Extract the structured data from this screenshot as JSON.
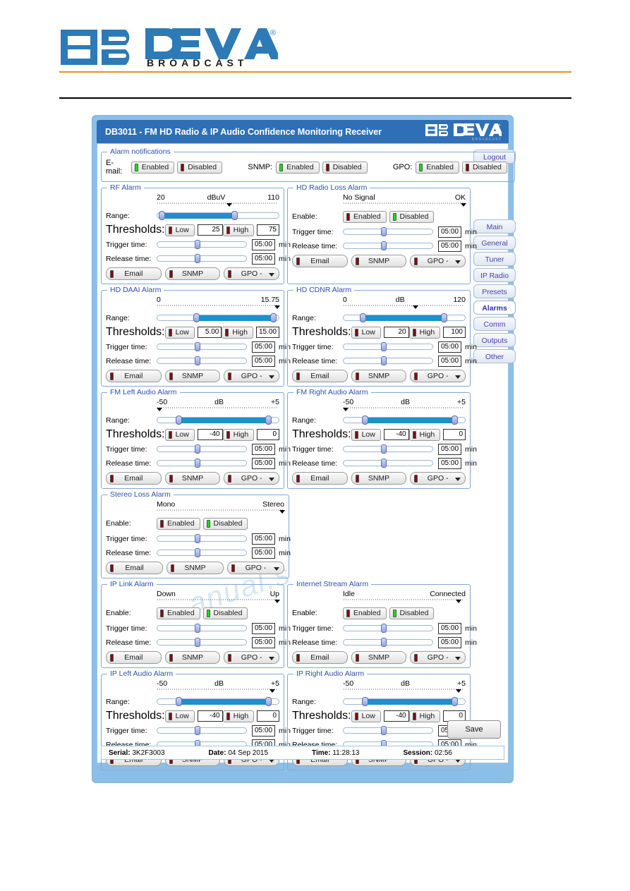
{
  "letterhead": {
    "brand": "DEVA",
    "sub": "BROADCAST",
    "registered": "®"
  },
  "window": {
    "title": "DB3011 - FM HD Radio & IP Audio Confidence Monitoring Receiver",
    "logo_brand": "DEVA",
    "logo_sub": "BROADCAST"
  },
  "notifications": {
    "legend": "Alarm notifications",
    "email_label": "E-mail:",
    "snmp_label": "SNMP:",
    "gpo_label": "GPO:",
    "enabled_label": "Enabled",
    "disabled_label": "Disabled",
    "email_state": "Enabled",
    "snmp_state": "Enabled",
    "gpo_state": "Enabled"
  },
  "labels": {
    "range": "Range:",
    "thresholds": "Thresholds:",
    "trigger_time": "Trigger time:",
    "release_time": "Release time:",
    "enable": "Enable:",
    "min": "min",
    "low": "Low",
    "high": "High",
    "email": "Email",
    "snmp": "SNMP",
    "gpo": "GPO -",
    "enabled": "Enabled",
    "disabled": "Disabled"
  },
  "alarms": [
    {
      "id": "rf-alarm",
      "legend": "RF Alarm",
      "kind": "range",
      "scale": {
        "left": "20",
        "mid": "dBuV",
        "right": "110",
        "caret_pct": 57
      },
      "range": {
        "low_pct": 4,
        "high_pct": 63
      },
      "low_value": "25",
      "high_value": "75",
      "trigger_time": "05:00",
      "release_time": "05:00",
      "trigger_pct": 45,
      "release_pct": 45
    },
    {
      "id": "hd-radio-loss-alarm",
      "legend": "HD Radio Loss Alarm",
      "kind": "enable",
      "scale": {
        "left": "No Signal",
        "mid": "",
        "right": "OK",
        "caret_pct": 96
      },
      "enable_state": "Disabled",
      "trigger_time": "05:00",
      "release_time": "05:00",
      "trigger_pct": 45,
      "release_pct": 45
    },
    {
      "id": "hd-daai-alarm",
      "legend": "HD DAAI Alarm",
      "kind": "range",
      "scale": {
        "left": "0",
        "mid": "",
        "right": "15.75",
        "caret_pct": 96
      },
      "range": {
        "low_pct": 32,
        "high_pct": 95
      },
      "low_value": "5.00",
      "high_value": "15.00",
      "trigger_time": "05:00",
      "release_time": "05:00",
      "trigger_pct": 45,
      "release_pct": 45
    },
    {
      "id": "hd-cdnr-alarm",
      "legend": "HD CDNR Alarm",
      "kind": "range",
      "scale": {
        "left": "0",
        "mid": "dB",
        "right": "120",
        "caret_pct": 57
      },
      "range": {
        "low_pct": 16,
        "high_pct": 82
      },
      "low_value": "20",
      "high_value": "100",
      "trigger_time": "05:00",
      "release_time": "05:00",
      "trigger_pct": 45,
      "release_pct": 45
    },
    {
      "id": "fm-left-audio-alarm",
      "legend": "FM Left Audio Alarm",
      "kind": "range",
      "scale": {
        "left": "-50",
        "mid": "dB",
        "right": "+5",
        "caret_pct": 0
      },
      "range": {
        "low_pct": 18,
        "high_pct": 91
      },
      "low_value": "-40",
      "high_value": "0",
      "trigger_time": "05:00",
      "release_time": "05:00",
      "trigger_pct": 45,
      "release_pct": 45
    },
    {
      "id": "fm-right-audio-alarm",
      "legend": "FM Right Audio Alarm",
      "kind": "range",
      "scale": {
        "left": "-50",
        "mid": "dB",
        "right": "+5",
        "caret_pct": 0
      },
      "range": {
        "low_pct": 18,
        "high_pct": 91
      },
      "low_value": "-40",
      "high_value": "0",
      "trigger_time": "05:00",
      "release_time": "05:00",
      "trigger_pct": 45,
      "release_pct": 45
    },
    {
      "id": "stereo-loss-alarm",
      "legend": "Stereo Loss Alarm",
      "kind": "enable",
      "scale": {
        "left": "Mono",
        "mid": "",
        "right": "Stereo",
        "caret_pct": 96
      },
      "enable_state": "Disabled",
      "trigger_time": "05:00",
      "release_time": "05:00",
      "trigger_pct": 45,
      "release_pct": 45
    },
    {
      "id": "ip-link-alarm",
      "legend": "IP Link Alarm",
      "kind": "enable",
      "scale": {
        "left": "Down",
        "mid": "",
        "right": "Up",
        "caret_pct": 96
      },
      "enable_state": "Disabled",
      "trigger_time": "05:00",
      "release_time": "05:00",
      "trigger_pct": 45,
      "release_pct": 45
    },
    {
      "id": "internet-stream-alarm",
      "legend": "Internet Stream Alarm",
      "kind": "enable",
      "scale": {
        "left": "Idle",
        "mid": "",
        "right": "Connected",
        "caret_pct": 92
      },
      "enable_state": "Disabled",
      "trigger_time": "05:00",
      "release_time": "05:00",
      "trigger_pct": 45,
      "release_pct": 45
    },
    {
      "id": "ip-left-audio-alarm",
      "legend": "IP Left Audio Alarm",
      "kind": "range",
      "scale": {
        "left": "-50",
        "mid": "dB",
        "right": "+5",
        "caret_pct": 92
      },
      "range": {
        "low_pct": 18,
        "high_pct": 91
      },
      "low_value": "-40",
      "high_value": "0",
      "trigger_time": "05:00",
      "release_time": "05:00",
      "trigger_pct": 45,
      "release_pct": 45
    },
    {
      "id": "ip-right-audio-alarm",
      "legend": "IP Right Audio Alarm",
      "kind": "range",
      "scale": {
        "left": "-50",
        "mid": "dB",
        "right": "+5",
        "caret_pct": 92
      },
      "range": {
        "low_pct": 18,
        "high_pct": 91
      },
      "low_value": "-40",
      "high_value": "0",
      "trigger_time": "05:00",
      "release_time": "05:00",
      "trigger_pct": 45,
      "release_pct": 45
    }
  ],
  "nav": {
    "logout": "Logout",
    "items": [
      {
        "label": "Main",
        "active": false
      },
      {
        "label": "General",
        "active": false
      },
      {
        "label": "Tuner",
        "active": false
      },
      {
        "label": "IP Radio",
        "active": false
      },
      {
        "label": "Presets",
        "active": false
      },
      {
        "label": "Alarms",
        "active": true
      },
      {
        "label": "Comm",
        "active": false
      },
      {
        "label": "Outputs",
        "active": false
      },
      {
        "label": "Other",
        "active": false
      }
    ]
  },
  "save_label": "Save",
  "status": {
    "serial_label": "Serial:",
    "serial_value": "3K2F3003",
    "date_label": "Date:",
    "date_value": "04 Sep 2015",
    "time_label": "Time:",
    "time_value": "11:28:13",
    "session_label": "Session:",
    "session_value": "02:56"
  },
  "colors": {
    "title_bar": "#2F6FB5",
    "panel_bg": "#8CBFE8",
    "legend_text": "#2F4FAF",
    "slider_fill": "#1E90CB",
    "led_green": "#17E017",
    "led_red": "#7E0D12",
    "nav_text": "#4B3FA8",
    "rule_orange": "#E8921A"
  }
}
